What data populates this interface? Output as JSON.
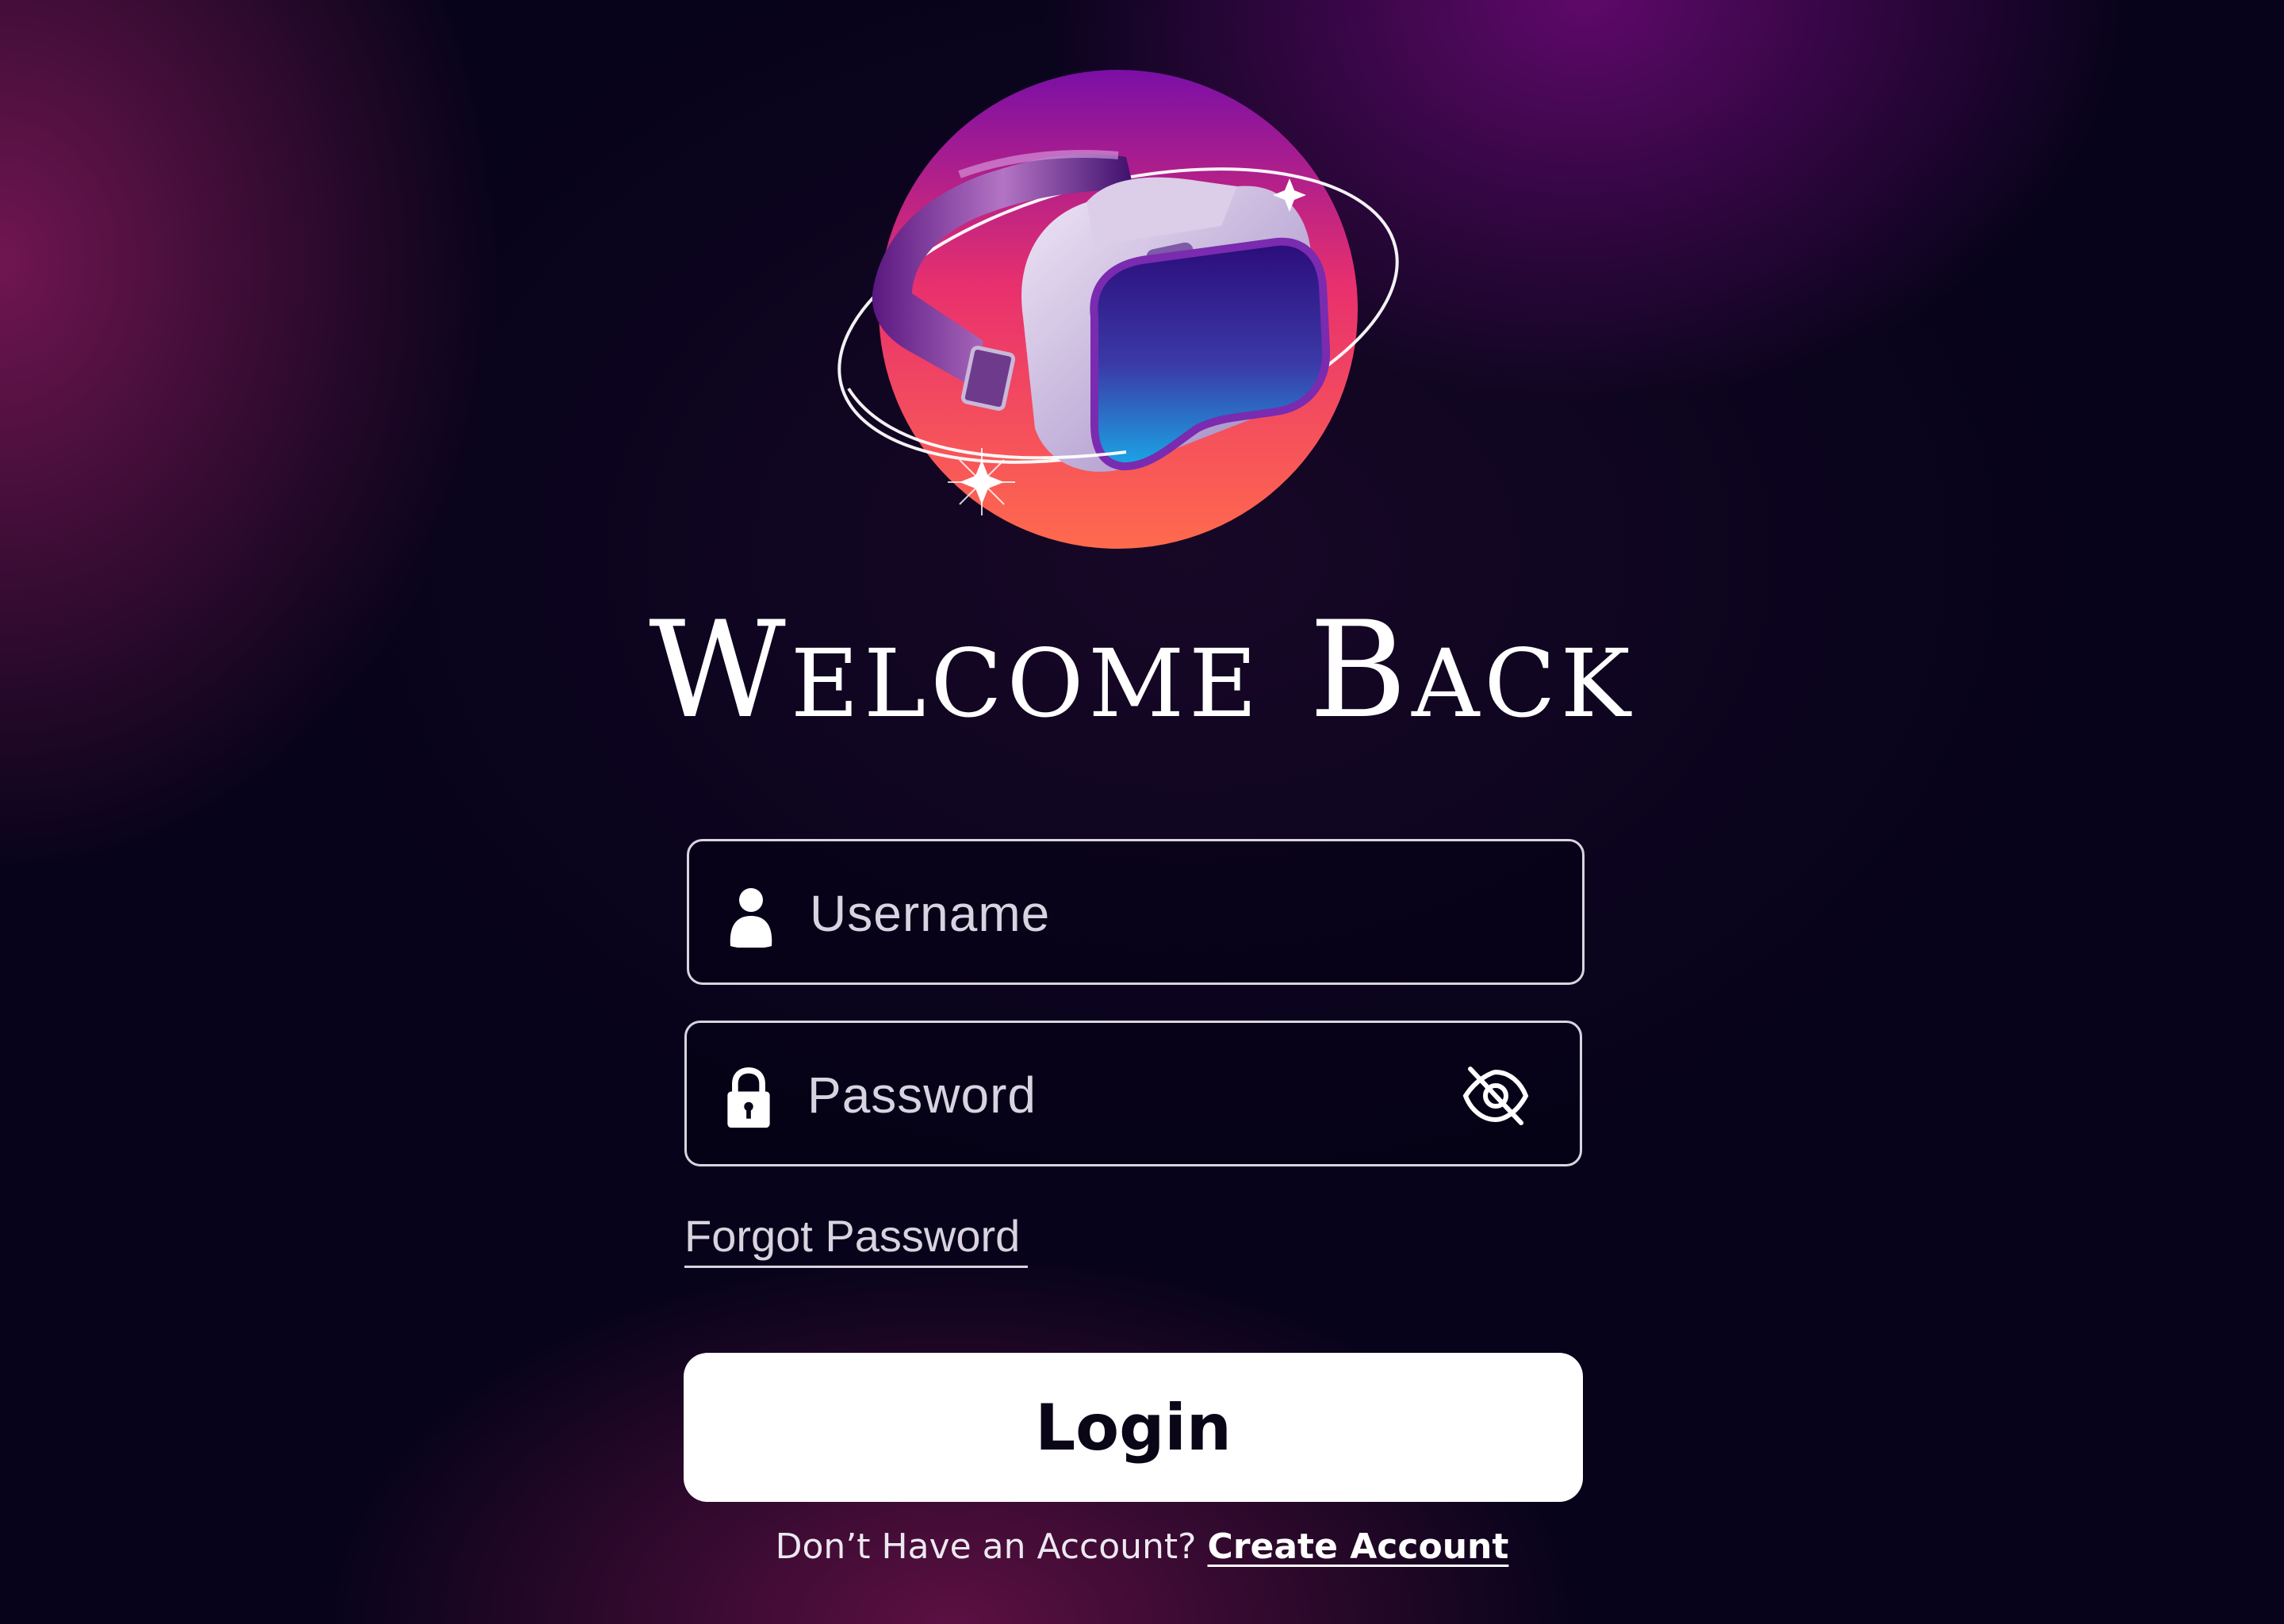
{
  "logo": {
    "icon": "vr-headset-logo",
    "colors": {
      "circle_top": "#7a0fa6",
      "circle_bottom": "#ff6a4d",
      "headset_body": "#c9b8da",
      "lens_top": "#2b0c7a",
      "lens_bottom": "#1aa6e6"
    }
  },
  "title": "Welcome Back",
  "username": {
    "icon": "user-icon",
    "placeholder": "Username",
    "value": ""
  },
  "password": {
    "icon": "lock-icon",
    "placeholder": "Password",
    "value": "",
    "toggle_icon": "eye-slash-icon"
  },
  "forgot_password": "Forgot Password",
  "login_button": "Login",
  "footer": {
    "prompt": "Don’t Have an Account?",
    "create_link": "Create Account"
  },
  "colors": {
    "background": "#07031a",
    "glow_magenta": "#82195a",
    "glow_purple": "#6e0a78",
    "button_bg": "#ffffff",
    "button_text": "#0a0618",
    "field_border": "#d9d4e0"
  }
}
